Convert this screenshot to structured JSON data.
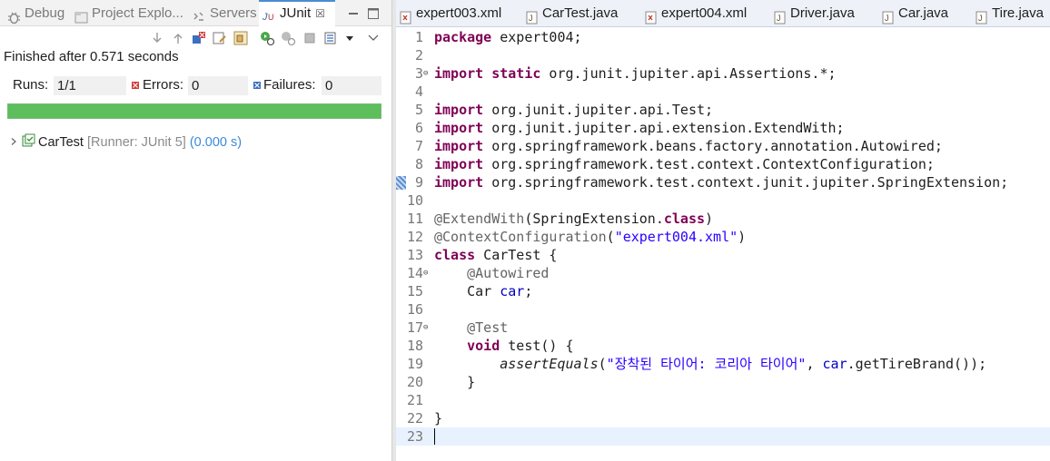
{
  "left_panel": {
    "tabs": [
      {
        "label": "Debug",
        "icon": "debug-icon"
      },
      {
        "label": "Project Explo...",
        "icon": "project-explorer-icon"
      },
      {
        "label": "Servers",
        "icon": "servers-icon"
      },
      {
        "label": "JUnit",
        "icon": "junit-icon",
        "close": "☒"
      }
    ],
    "toolbar_icons": [
      "next-failure-icon",
      "previous-failure-icon",
      "show-failures-only-icon",
      "scroll-lock-icon",
      "test-history-icon",
      "rerun-test-icon",
      "rerun-failed-first-icon",
      "stop-icon",
      "layout-menu-icon",
      "view-menu-icon"
    ],
    "status_text": "Finished after 0.571 seconds",
    "counters": {
      "runs_label": "Runs:",
      "runs_value": "1/1",
      "errors_label": "Errors:",
      "errors_value": "0",
      "failures_label": "Failures:",
      "failures_value": "0"
    },
    "progress_color": "#5cbf5c",
    "progress_fraction": 1.0,
    "tree": {
      "item_label": "CarTest",
      "runner_text": "[Runner: JUnit 5]",
      "time_text": "(0.000 s)"
    }
  },
  "editor": {
    "tabs": [
      {
        "label": "expert003.xml",
        "icon": "xml-file-icon"
      },
      {
        "label": "CarTest.java",
        "icon": "java-file-icon",
        "active": true
      },
      {
        "label": "expert004.xml",
        "icon": "xml-file-icon"
      },
      {
        "label": "Driver.java",
        "icon": "java-file-icon"
      },
      {
        "label": "Car.java",
        "icon": "java-file-icon"
      },
      {
        "label": "Tire.java",
        "icon": "java-file-icon"
      }
    ],
    "line_numbers": [
      "1",
      "2",
      "3",
      "4",
      "5",
      "6",
      "7",
      "8",
      "9",
      "10",
      "11",
      "12",
      "13",
      "14",
      "15",
      "16",
      "17",
      "18",
      "19",
      "20",
      "21",
      "22",
      "23"
    ],
    "lines": {
      "l1": {
        "kw": "package",
        "rest": " expert004;"
      },
      "l3": {
        "kw1": "import",
        "kw2": "static",
        "rest": " org.junit.jupiter.api.Assertions.*;"
      },
      "l5": {
        "kw": "import",
        "rest": " org.junit.jupiter.api.Test;"
      },
      "l6": {
        "kw": "import",
        "rest": " org.junit.jupiter.api.extension.ExtendWith;"
      },
      "l7": {
        "kw": "import",
        "rest": " org.springframework.beans.factory.annotation.Autowired;"
      },
      "l8": {
        "kw": "import",
        "rest": " org.springframework.test.context.ContextConfiguration;"
      },
      "l9": {
        "kw": "import",
        "rest": " org.springframework.test.context.junit.jupiter.SpringExtension;"
      },
      "l11": {
        "an": "@ExtendWith",
        "pre": "(SpringExtension.",
        "kw": "class",
        "post": ")"
      },
      "l12": {
        "an": "@ContextConfiguration",
        "pre": "(",
        "str": "\"expert004.xml\"",
        "post": ")"
      },
      "l13": {
        "kw": "class",
        "rest": " CarTest {"
      },
      "l14": {
        "indent": "    ",
        "an": "@Autowired"
      },
      "l15": {
        "indent": "    ",
        "type": "Car ",
        "fld": "car",
        "post": ";"
      },
      "l17": {
        "indent": "    ",
        "an": "@Test"
      },
      "l18": {
        "indent": "    ",
        "kw": "void",
        "rest": " test() {"
      },
      "l19": {
        "indent": "        ",
        "it": "assertEquals",
        "pre": "(",
        "str": "\"장착된 타이어: 코리아 타이어\"",
        "mid": ", ",
        "fld": "car",
        "post": ".getTireBrand());"
      },
      "l20": {
        "indent": "    ",
        "rest": "}"
      },
      "l22": {
        "rest": "}"
      }
    }
  }
}
